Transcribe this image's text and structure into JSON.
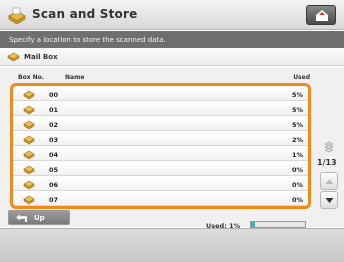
{
  "header": {
    "title": "Scan and Store",
    "title_icon": "scan-store-icon",
    "home_icon": "home-icon"
  },
  "info": {
    "message": "Specify a location to store the scanned data."
  },
  "location": {
    "icon": "mailbox-icon",
    "label": "Mail Box"
  },
  "table": {
    "columns": {
      "box_no": "Box No.",
      "name": "Name",
      "used": "Used"
    },
    "rows": [
      {
        "box_no": "00",
        "name": "",
        "used": "5%"
      },
      {
        "box_no": "01",
        "name": "",
        "used": "5%"
      },
      {
        "box_no": "02",
        "name": "",
        "used": "5%"
      },
      {
        "box_no": "03",
        "name": "",
        "used": "2%"
      },
      {
        "box_no": "04",
        "name": "",
        "used": "1%"
      },
      {
        "box_no": "05",
        "name": "",
        "used": "0%"
      },
      {
        "box_no": "06",
        "name": "",
        "used": "0%"
      },
      {
        "box_no": "07",
        "name": "",
        "used": "0%"
      }
    ]
  },
  "pager": {
    "page": "1/13",
    "up_icon": "scroll-up-icon",
    "down_icon": "scroll-down-icon"
  },
  "footer": {
    "up_label": "Up",
    "up_icon": "back-arrow-icon",
    "used_label": "Used:",
    "used_value": "1%",
    "used_fraction": 0.08
  },
  "colors": {
    "accent": "#f28a1b",
    "info_bar": "#6f6f6f",
    "memory_fill": "#3db3a7"
  }
}
